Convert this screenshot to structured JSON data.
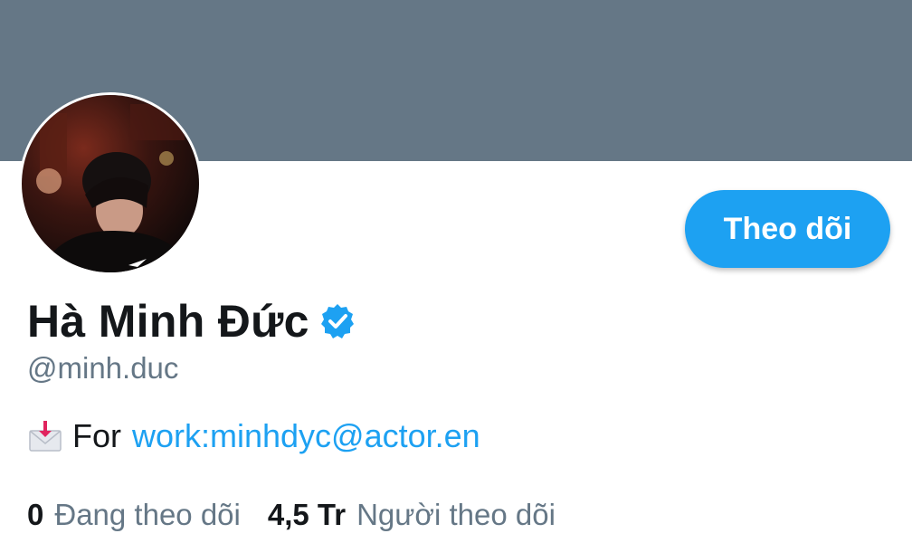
{
  "profile": {
    "display_name": "Hà Minh Đức",
    "handle": "@minh.duc",
    "verified_icon": "verified-badge-icon",
    "avatar_icon": "profile-photo"
  },
  "follow_button": {
    "label": "Theo dõi"
  },
  "bio": {
    "icon": "envelope-with-arrow-icon",
    "prefix": "For",
    "link_text": "work:minhdyc@actor.en"
  },
  "stats": {
    "following_count": "0",
    "following_label": "Đang theo dõi",
    "followers_count": "4,5 Tr",
    "followers_label": "Người theo dõi"
  },
  "colors": {
    "banner": "#657786",
    "accent": "#1da1f2",
    "text_primary": "#14171a",
    "text_secondary": "#657786"
  }
}
